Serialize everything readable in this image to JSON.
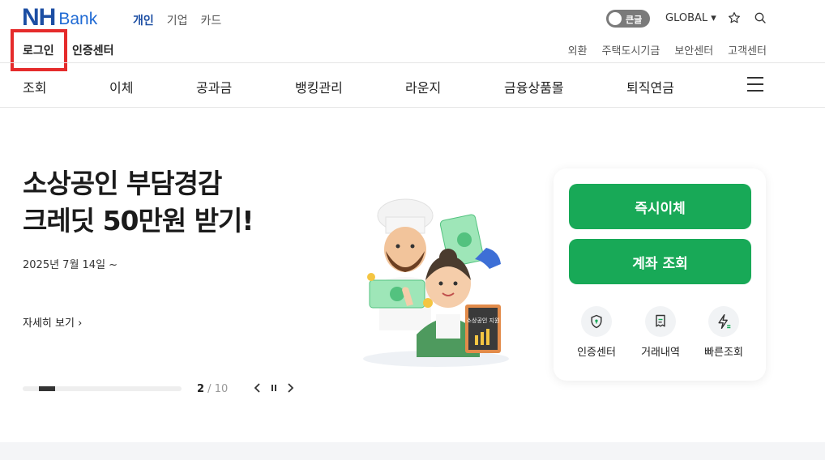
{
  "logo": {
    "nh": "NH",
    "bank": "Bank"
  },
  "site_tabs": [
    "개인",
    "기업",
    "카드"
  ],
  "util": {
    "toggle_label": "큰글",
    "global": "GLOBAL ▾",
    "favorite_icon": "star-icon",
    "search_icon": "search-icon"
  },
  "login": "로그인",
  "cert_center": "인증센터",
  "sub_links": [
    "외환",
    "주택도시기금",
    "보안센터",
    "고객센터"
  ],
  "main_nav": [
    "조회",
    "이체",
    "공과금",
    "뱅킹관리",
    "라운지",
    "금융상품몰",
    "퇴직연금"
  ],
  "hero": {
    "title_line1": "소상공인 부담경감",
    "title_line2": "크레딧 50만원 받기!",
    "date": "2025년 7월 14일 ~",
    "detail": "자세히 보기 ›",
    "illust_sign": "소상공인 지원"
  },
  "slider": {
    "current": "2",
    "total": " / 10",
    "progress": 0.2
  },
  "panel": {
    "transfer_btn": "즉시이체",
    "account_btn": "계좌 조회",
    "quick": [
      "인증센터",
      "거래내역",
      "빠른조회"
    ]
  },
  "colors": {
    "brand": "#1c4ea3",
    "accent_green": "#18a957",
    "highlight": "#e52b2b"
  }
}
